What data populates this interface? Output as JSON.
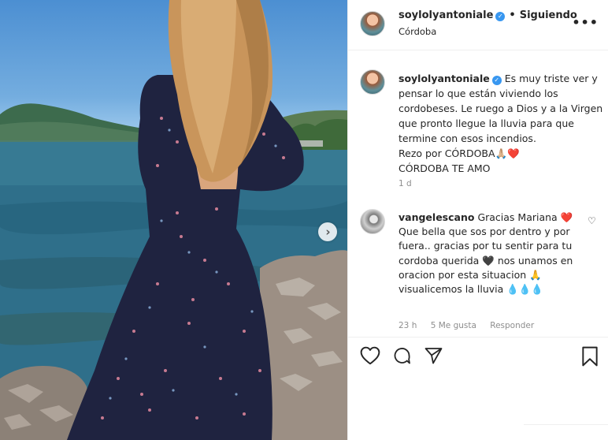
{
  "post": {
    "username": "soylolyantoniale",
    "follow_status": "Siguiendo",
    "location": "Córdoba",
    "more_label": "•••",
    "caption": "Es muy triste ver y pensar lo que están viviendo los cordobeses. Le ruego a Dios y a la Virgen que pronto llegue la lluvia para que termine con esos incendios.",
    "caption_line2": "Rezo por CÓRDOBA🙏🏼❤️",
    "caption_line3": "CÓRDOBA TE AMO",
    "time": "1 d"
  },
  "comment": {
    "username": "vangelescano",
    "text": "Gracias Mariana ❤️ Que bella que sos por dentro y por fuera.. gracias por tu sentir para tu cordoba querida 🖤 nos unamos en oracion por esta situacion 🙏 visualicemos la lluvia 💧💧💧",
    "time": "23 h",
    "likes": "5 Me gusta",
    "reply": "Responder"
  },
  "icons": {
    "verified": "verified-badge-icon",
    "like": "heart-icon",
    "comment": "comment-icon",
    "share": "paper-plane-icon",
    "save": "bookmark-icon",
    "next": "chevron-right-icon"
  },
  "colors": {
    "verified": "#3897f0",
    "muted": "#8e8e8e",
    "text": "#262626",
    "border": "#efefef"
  }
}
